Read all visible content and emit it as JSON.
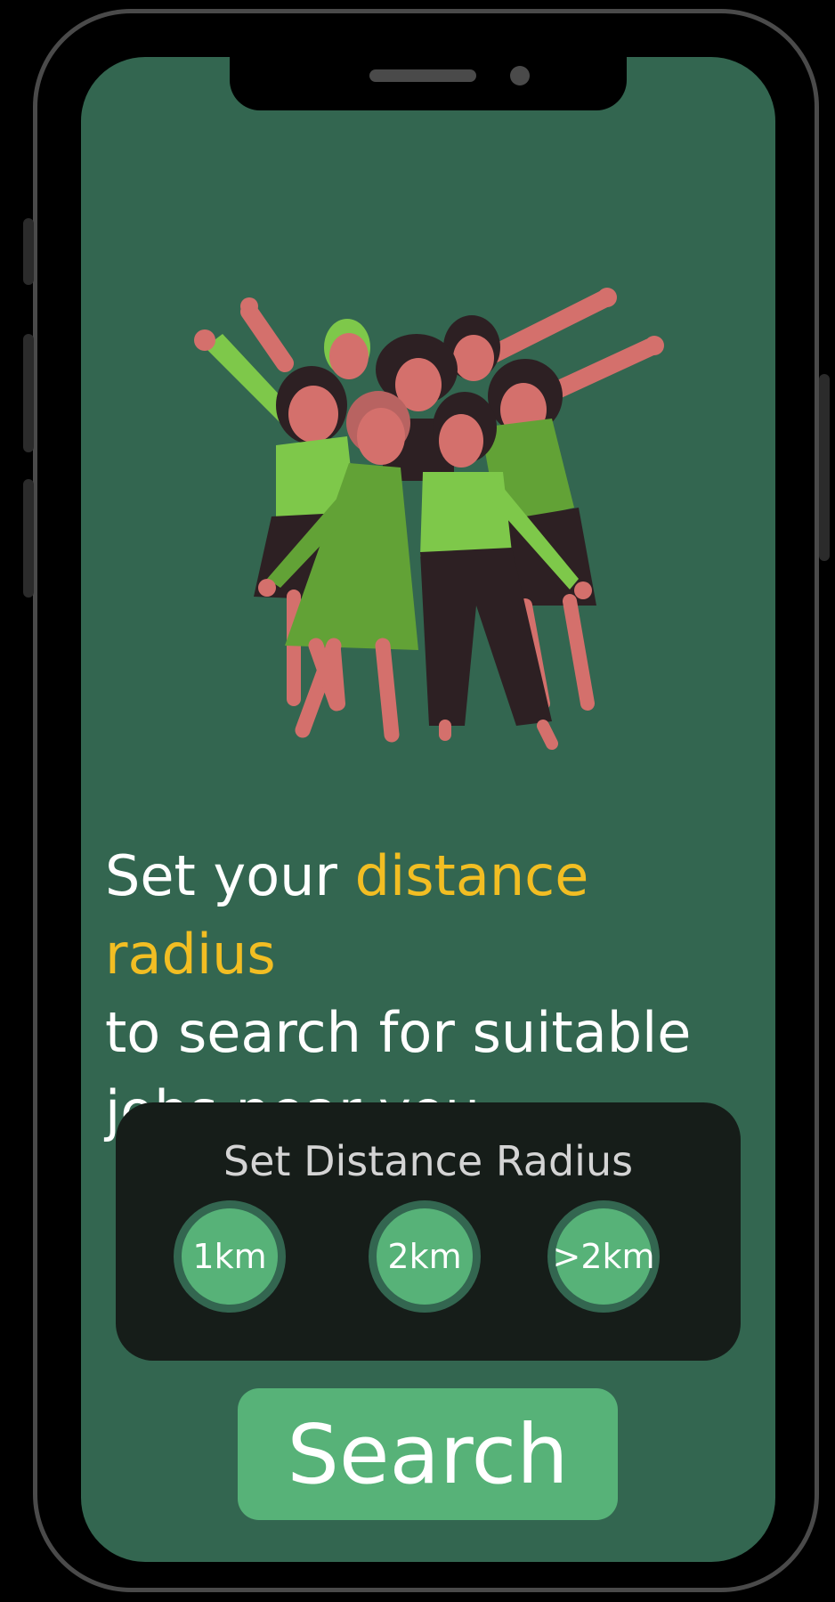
{
  "headline": {
    "prefix": "Set your ",
    "highlight": "distance radius",
    "line2": "to search for suitable",
    "line3": "jobs near you..."
  },
  "radius_card": {
    "title": "Set Distance Radius",
    "options": [
      "1km",
      "2km",
      ">2km"
    ]
  },
  "search_button": {
    "label": "Search"
  },
  "colors": {
    "screen_bg": "#336650",
    "accent_yellow": "#f2be23",
    "button_green": "#57b278",
    "card_bg": "#161d19"
  },
  "illustration": {
    "icon": "group-of-women-celebrating-illustration"
  }
}
